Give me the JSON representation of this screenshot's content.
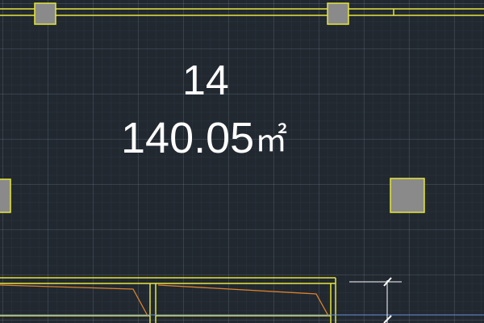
{
  "room": {
    "number": "14",
    "area_value": "140.05",
    "area_unit": "㎡"
  },
  "colors": {
    "background": "#212830",
    "wall_lines": "#e6e63a",
    "column_fill": "#8a8a8a",
    "door_swing": "#d9822b",
    "dimension_line": "#ffffff",
    "axis_line": "#6b8fd6",
    "text": "#ffffff"
  }
}
